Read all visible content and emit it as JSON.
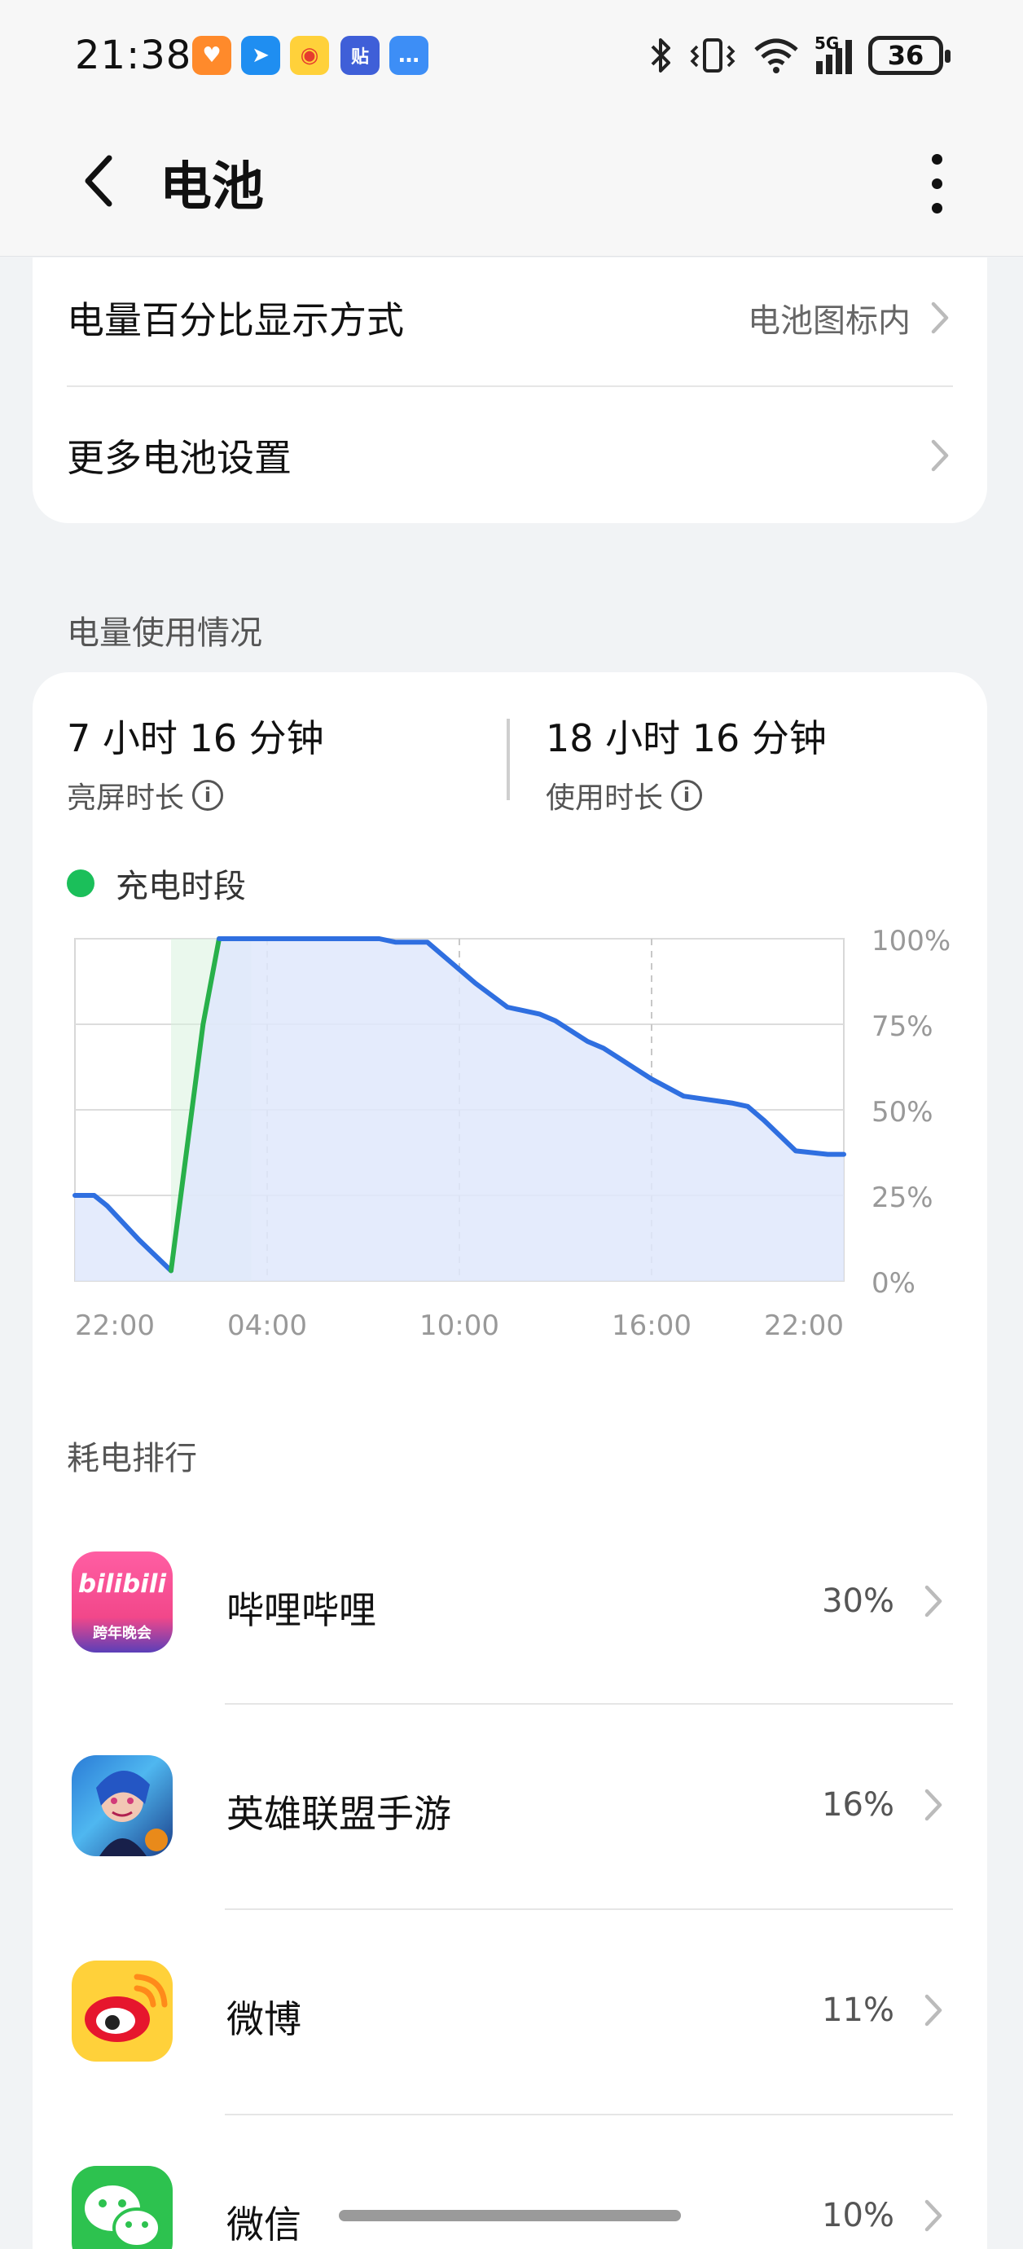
{
  "status_bar": {
    "time": "21:38",
    "network": "5G",
    "battery_level": "36"
  },
  "header": {
    "title": "电池"
  },
  "settings": [
    {
      "label": "电量百分比显示方式",
      "value": "电池图标内"
    },
    {
      "label": "更多电池设置",
      "value": ""
    }
  ],
  "usage": {
    "section_title": "电量使用情况",
    "screen_on_time": "7 小时 16 分钟",
    "screen_on_label": "亮屏时长",
    "usage_time": "18 小时 16 分钟",
    "usage_label": "使用时长",
    "legend_label": "充电时段"
  },
  "chart_data": {
    "type": "area",
    "x_ticks": [
      "22:00",
      "04:00",
      "10:00",
      "16:00",
      "22:00"
    ],
    "y_ticks": [
      "100%",
      "75%",
      "50%",
      "25%",
      "0%"
    ],
    "ylim": [
      0,
      100
    ],
    "xlim_hours": [
      0,
      24
    ],
    "charging_range_hours": [
      3.0,
      5.5
    ],
    "series": [
      {
        "x": [
          0,
          0.6,
          1.0,
          2.0,
          3.0,
          4.0,
          4.5,
          5.5,
          6.0,
          9.5,
          10.0,
          11.0,
          12.5,
          13.5,
          14.5,
          15.0,
          16.0,
          16.5,
          17.5,
          18.0,
          19.0,
          20.5,
          21.0,
          21.5,
          22.5,
          23.5,
          24.0
        ],
        "y": [
          25,
          25,
          22,
          12,
          3,
          75,
          100,
          100,
          100,
          100,
          99,
          99,
          87,
          80,
          78,
          76,
          70,
          68,
          62,
          59,
          54,
          52,
          51,
          47,
          38,
          37,
          37
        ]
      }
    ],
    "colors": {
      "line": "#2f6fe0",
      "fill": "#dfe8fb",
      "charging_line": "#28b04a",
      "charging_fill": "#d8f3de"
    }
  },
  "ranking": {
    "section_title": "耗电排行",
    "apps": [
      {
        "name": "哔哩哔哩",
        "percent": "30%",
        "icon": "bilibili-icon",
        "icon_text": "bilibili",
        "icon_subtext": "跨年晚会"
      },
      {
        "name": "英雄联盟手游",
        "percent": "16%",
        "icon": "lol-icon"
      },
      {
        "name": "微博",
        "percent": "11%",
        "icon": "weibo-icon"
      },
      {
        "name": "微信",
        "percent": "10%",
        "icon": "wechat-icon"
      }
    ]
  },
  "colors": {
    "accent_green": "#1bbf5a",
    "bilibili_pink": "#f25d8e",
    "weibo_yellow": "#ffd13a",
    "wechat_green": "#2dc24f"
  }
}
